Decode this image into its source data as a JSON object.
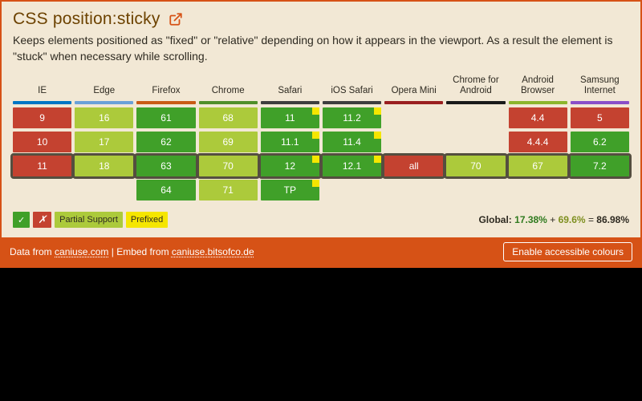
{
  "feature": {
    "title": "CSS position:sticky",
    "description": "Keeps elements positioned as \"fixed\" or \"relative\" depending on how it appears in the viewport. As a result the element is \"stuck\" when necessary while scrolling."
  },
  "browsers": [
    {
      "name": "IE",
      "rule_color": "#0076c4"
    },
    {
      "name": "Edge",
      "rule_color": "#6aa1d8"
    },
    {
      "name": "Firefox",
      "rule_color": "#c95a15"
    },
    {
      "name": "Chrome",
      "rule_color": "#4f8f2a"
    },
    {
      "name": "Safari",
      "rule_color": "#3e3e3e"
    },
    {
      "name": "iOS Safari",
      "rule_color": "#3e3e3e"
    },
    {
      "name": "Opera Mini",
      "rule_color": "#9a1f1f"
    },
    {
      "name": "Chrome for Android",
      "rule_color": "#1a1a1a"
    },
    {
      "name": "Android Browser",
      "rule_color": "#8cb52c"
    },
    {
      "name": "Samsung Internet",
      "rule_color": "#8a4fc9"
    }
  ],
  "rows": [
    [
      {
        "v": "9",
        "s": "nos"
      },
      {
        "v": "16",
        "s": "par"
      },
      {
        "v": "61",
        "s": "sup"
      },
      {
        "v": "68",
        "s": "par"
      },
      {
        "v": "11",
        "s": "sup",
        "p": true
      },
      {
        "v": "11.2",
        "s": "sup",
        "p": true
      },
      null,
      null,
      {
        "v": "4.4",
        "s": "nos"
      },
      {
        "v": "5",
        "s": "nos"
      }
    ],
    [
      {
        "v": "10",
        "s": "nos"
      },
      {
        "v": "17",
        "s": "par"
      },
      {
        "v": "62",
        "s": "sup"
      },
      {
        "v": "69",
        "s": "par"
      },
      {
        "v": "11.1",
        "s": "sup",
        "p": true
      },
      {
        "v": "11.4",
        "s": "sup",
        "p": true
      },
      null,
      null,
      {
        "v": "4.4.4",
        "s": "nos"
      },
      {
        "v": "6.2",
        "s": "sup"
      }
    ],
    [
      {
        "v": "11",
        "s": "nos"
      },
      {
        "v": "18",
        "s": "par"
      },
      {
        "v": "63",
        "s": "sup"
      },
      {
        "v": "70",
        "s": "par"
      },
      {
        "v": "12",
        "s": "sup",
        "p": true
      },
      {
        "v": "12.1",
        "s": "sup",
        "p": true
      },
      {
        "v": "all",
        "s": "nos"
      },
      {
        "v": "70",
        "s": "par"
      },
      {
        "v": "67",
        "s": "par"
      },
      {
        "v": "7.2",
        "s": "sup"
      }
    ],
    [
      null,
      null,
      {
        "v": "64",
        "s": "sup"
      },
      {
        "v": "71",
        "s": "par"
      },
      {
        "v": "TP",
        "s": "sup",
        "p": true
      },
      null,
      null,
      null,
      null,
      null
    ]
  ],
  "current_row_index": 2,
  "legend": {
    "supported_mark": "✓",
    "unsupported_mark": "✗",
    "partial": "Partial Support",
    "prefixed": "Prefixed"
  },
  "global_stats": {
    "label": "Global:",
    "supported_pct": "17.38%",
    "plus": "+",
    "partial_pct": "69.6%",
    "equals": "=",
    "total_pct": "86.98%"
  },
  "footer": {
    "data_from": "Data from",
    "source1": "caniuse.com",
    "sep": " | ",
    "embed_from": "Embed from",
    "source2": "caniuse.bitsofco.de",
    "button": "Enable accessible colours"
  }
}
